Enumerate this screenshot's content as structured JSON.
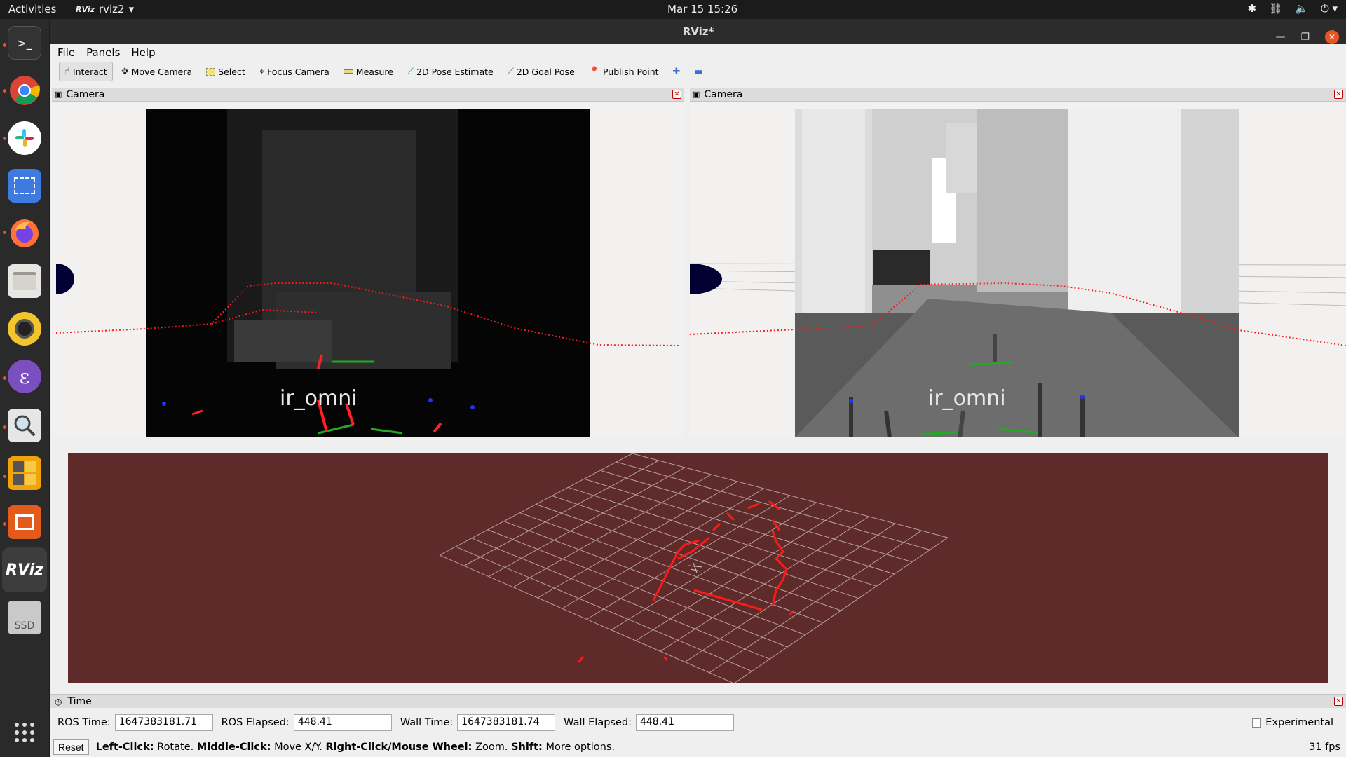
{
  "topbar": {
    "activities": "Activities",
    "app_name": "rviz2",
    "app_logo_text": "RViz",
    "clock": "Mar 15  15:26"
  },
  "dock": {
    "items": [
      "terminal-icon",
      "chrome-icon",
      "slack-icon",
      "screenshot-icon",
      "firefox-icon",
      "files-icon",
      "rhythmbox-icon",
      "emacs-icon",
      "magnifier-icon",
      "calculator-icon",
      "impress-icon",
      "rviz-icon",
      "ssd-icon"
    ],
    "rviz_label": "RViz",
    "ssd_label": "SSD"
  },
  "window": {
    "title": "RViz*"
  },
  "menu": [
    "File",
    "Panels",
    "Help"
  ],
  "toolbar": {
    "interact": "Interact",
    "move_camera": "Move Camera",
    "select": "Select",
    "focus_camera": "Focus Camera",
    "measure": "Measure",
    "pose_estimate": "2D Pose Estimate",
    "goal_pose": "2D Goal Pose",
    "publish_point": "Publish Point"
  },
  "panels": {
    "camera_left_title": "Camera",
    "camera_right_title": "Camera",
    "frame_label_left": "ir_omni",
    "frame_label_right": "ir_omni"
  },
  "time": {
    "title": "Time",
    "ros_time_label": "ROS Time:",
    "ros_time": "1647383181.71",
    "ros_elapsed_label": "ROS Elapsed:",
    "ros_elapsed": "448.41",
    "wall_time_label": "Wall Time:",
    "wall_time": "1647383181.74",
    "wall_elapsed_label": "Wall Elapsed:",
    "wall_elapsed": "448.41",
    "experimental": "Experimental"
  },
  "status": {
    "reset": "Reset",
    "left_click": "Left-Click:",
    "left_click_desc": "Rotate.",
    "middle_click": "Middle-Click:",
    "middle_click_desc": "Move X/Y.",
    "right_click": "Right-Click/Mouse Wheel:",
    "right_click_desc": "Zoom.",
    "shift": "Shift:",
    "shift_desc": "More options.",
    "fps": "31 fps"
  },
  "colors": {
    "view3d_bg": "#5e2a2a",
    "laser": "#ff1a1a",
    "grid": "#b9a0a0"
  }
}
